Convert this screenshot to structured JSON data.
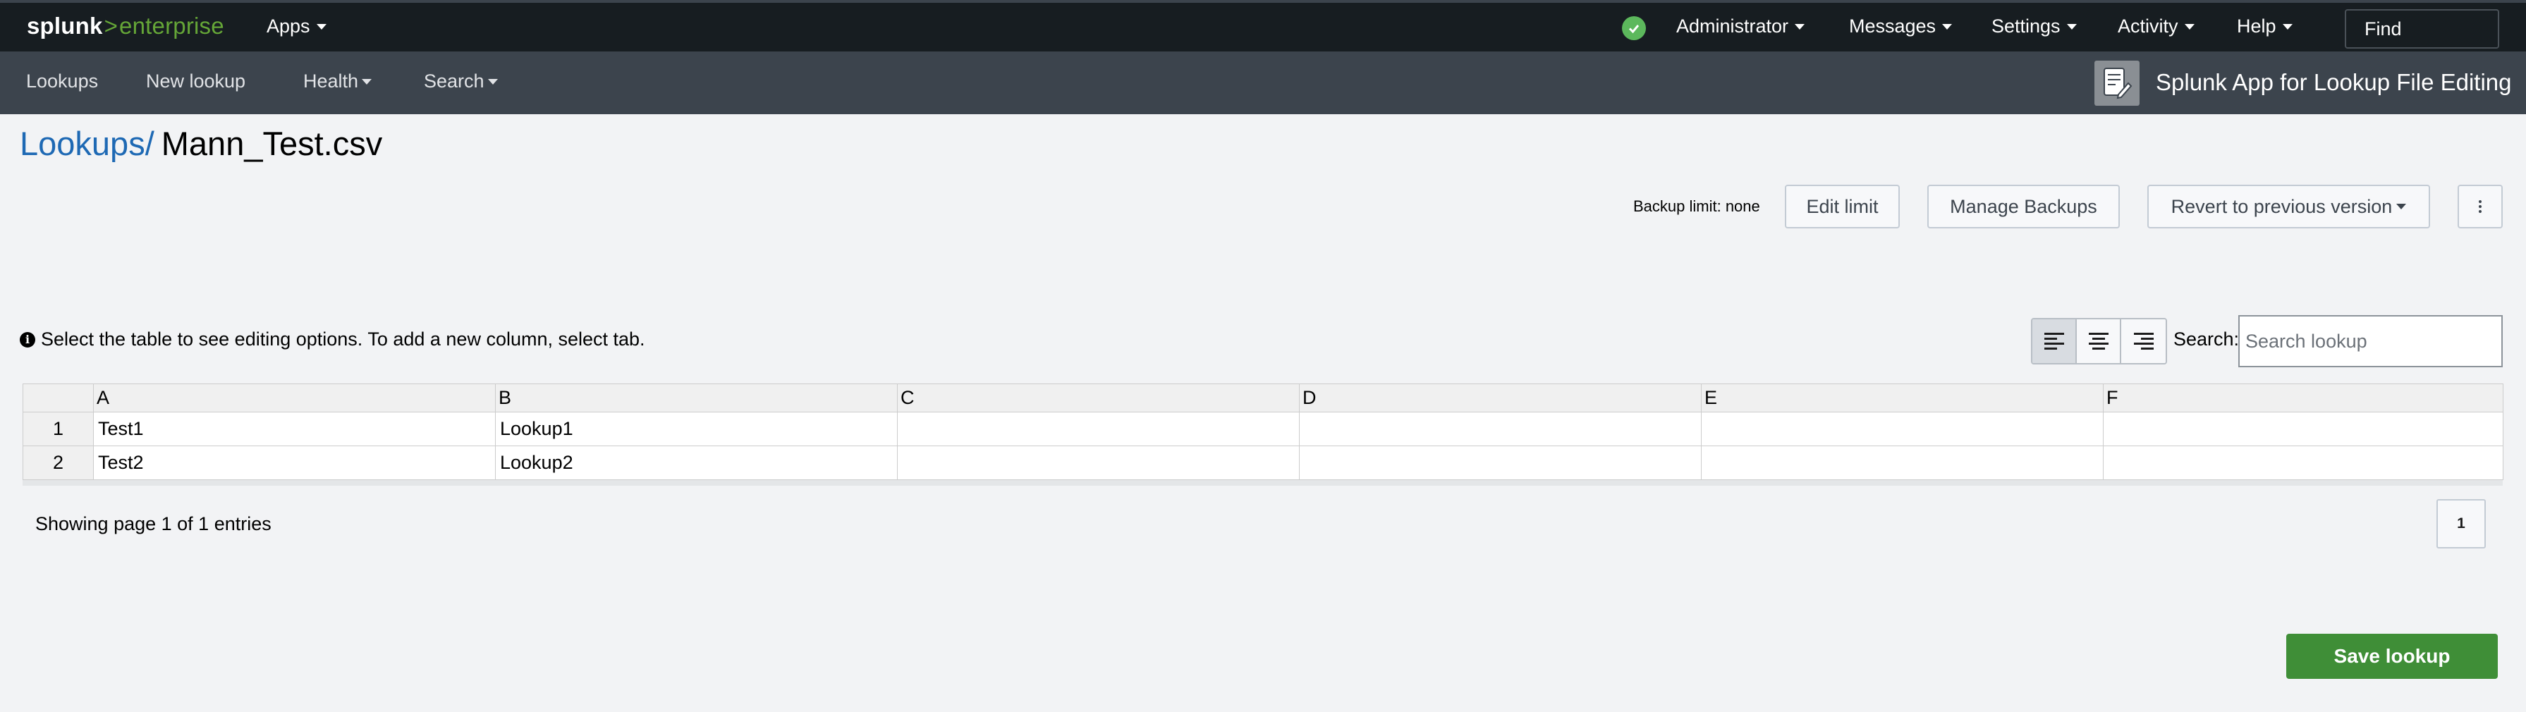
{
  "topbar": {
    "logo_brand": "splunk",
    "logo_gt": ">",
    "logo_product": "enterprise",
    "apps_label": "Apps",
    "health_icon": "check-circle-icon",
    "admin_label": "Administrator",
    "messages_label": "Messages",
    "settings_label": "Settings",
    "activity_label": "Activity",
    "help_label": "Help",
    "find_label": "Find",
    "colors": {
      "bg": "#171d21",
      "accent": "#65a637",
      "health": "#5cb85c"
    }
  },
  "appbar": {
    "items": [
      {
        "label": "Lookups",
        "dropdown": false
      },
      {
        "label": "New lookup",
        "dropdown": false
      },
      {
        "label": "Health",
        "dropdown": true
      },
      {
        "label": "Search",
        "dropdown": true
      }
    ],
    "app_icon": "edit-document-icon",
    "app_title": "Splunk App for Lookup File Editing",
    "colors": {
      "bg": "#3c444d"
    }
  },
  "breadcrumb": {
    "parent": "Lookups/",
    "current": "Mann_Test.csv"
  },
  "backup": {
    "limit_label": "Backup limit: none",
    "edit_limit": "Edit limit",
    "manage_backups": "Manage Backups",
    "revert": "Revert to previous version",
    "more_icon": "vertical-ellipsis-icon"
  },
  "editor": {
    "info_icon": "info-icon",
    "info_text": "Select the table to see editing options. To add a new column, select tab.",
    "align_buttons": [
      "align-left-icon",
      "align-center-icon",
      "align-right-icon"
    ],
    "active_align": "align-left-icon",
    "search_label": "Search:",
    "search_placeholder": "Search lookup"
  },
  "table": {
    "columns": [
      "A",
      "B",
      "C",
      "D",
      "E",
      "F"
    ],
    "rows": [
      {
        "num": "1",
        "cells": [
          "Test1",
          "Lookup1",
          "",
          "",
          "",
          ""
        ]
      },
      {
        "num": "2",
        "cells": [
          "Test2",
          "Lookup2",
          "",
          "",
          "",
          ""
        ]
      }
    ]
  },
  "pager": {
    "text": "Showing page 1 of 1 entries",
    "current_page": "1"
  },
  "save_label": "Save lookup",
  "save_color": "#3f8e37"
}
